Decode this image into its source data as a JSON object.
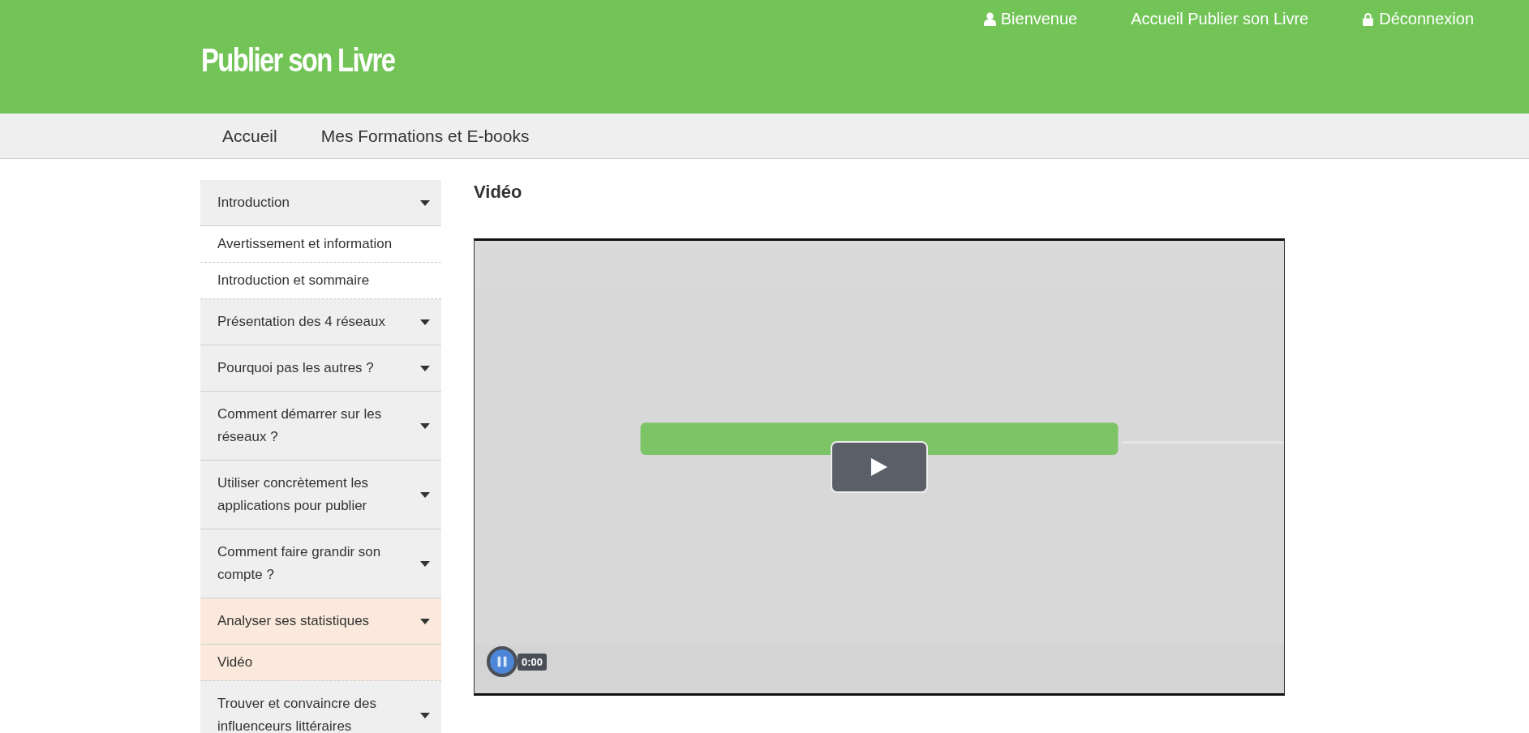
{
  "header": {
    "logo": "Publier son Livre",
    "links": [
      {
        "label": "Bienvenue"
      },
      {
        "label": "Accueil Publier son Livre"
      },
      {
        "label": "Déconnexion"
      }
    ]
  },
  "nav": [
    "Accueil",
    "Mes Formations et E-books"
  ],
  "sidebar": {
    "sections": [
      {
        "label": "Introduction",
        "selected": false,
        "children": [
          {
            "label": "Avertissement et information",
            "selected": false
          },
          {
            "label": "Introduction et sommaire",
            "selected": false
          }
        ]
      },
      {
        "label": "Présentation des 4 réseaux",
        "selected": false
      },
      {
        "label": "Pourquoi pas les autres ?",
        "selected": false
      },
      {
        "label": "Comment démarrer sur les réseaux ?",
        "selected": false
      },
      {
        "label": "Utiliser concrètement les applications pour publier",
        "selected": false
      },
      {
        "label": "Comment faire grandir son compte ?",
        "selected": false
      },
      {
        "label": "Analyser ses statistiques",
        "selected": true,
        "children": [
          {
            "label": "Vidéo",
            "selected": true
          }
        ]
      },
      {
        "label": "Trouver et convaincre des influenceurs littéraires",
        "selected": false
      }
    ]
  },
  "content": {
    "title": "Vidéo",
    "video": {
      "kind": "picture",
      "playing": true,
      "time": "0:00"
    }
  }
}
